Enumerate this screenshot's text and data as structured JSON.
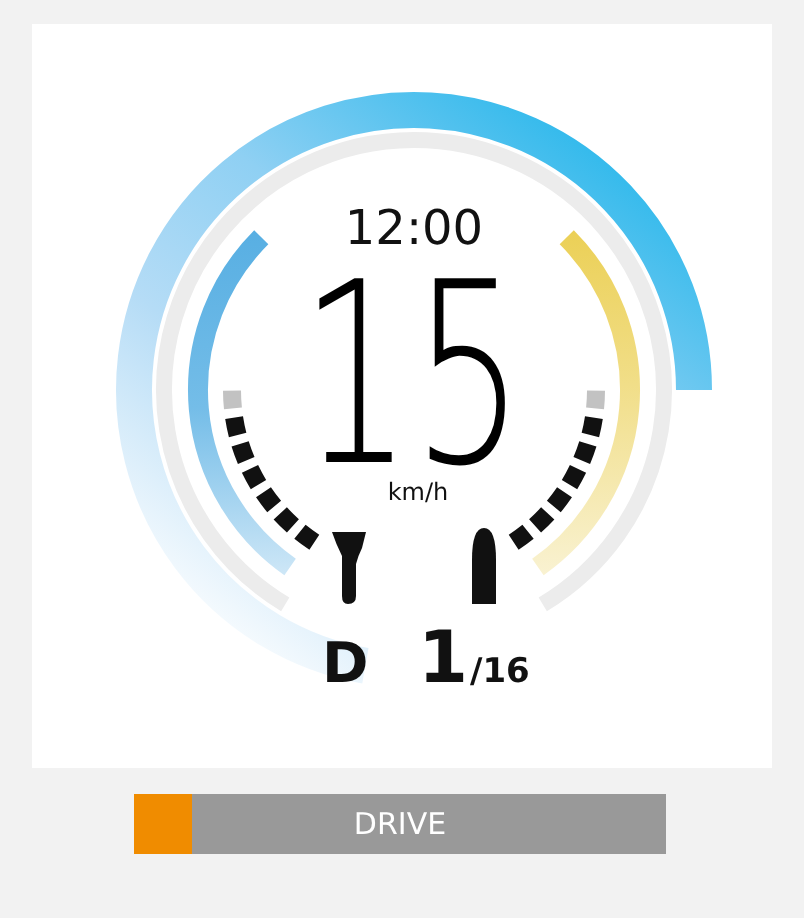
{
  "gauge": {
    "clock": "12:00",
    "speed": "15",
    "unit": "km/h",
    "mode_letter": "D",
    "gear": "1",
    "gear_total": "/16",
    "left_segments": [
      {
        "on": true
      },
      {
        "on": true
      },
      {
        "on": true
      },
      {
        "on": true
      },
      {
        "on": true
      },
      {
        "on": true
      },
      {
        "on": false
      }
    ],
    "right_segments": [
      {
        "on": true
      },
      {
        "on": true
      },
      {
        "on": true
      },
      {
        "on": true
      },
      {
        "on": true
      },
      {
        "on": true
      },
      {
        "on": false
      }
    ]
  },
  "mode_bar": {
    "label": "DRIVE",
    "level": 0.11
  }
}
